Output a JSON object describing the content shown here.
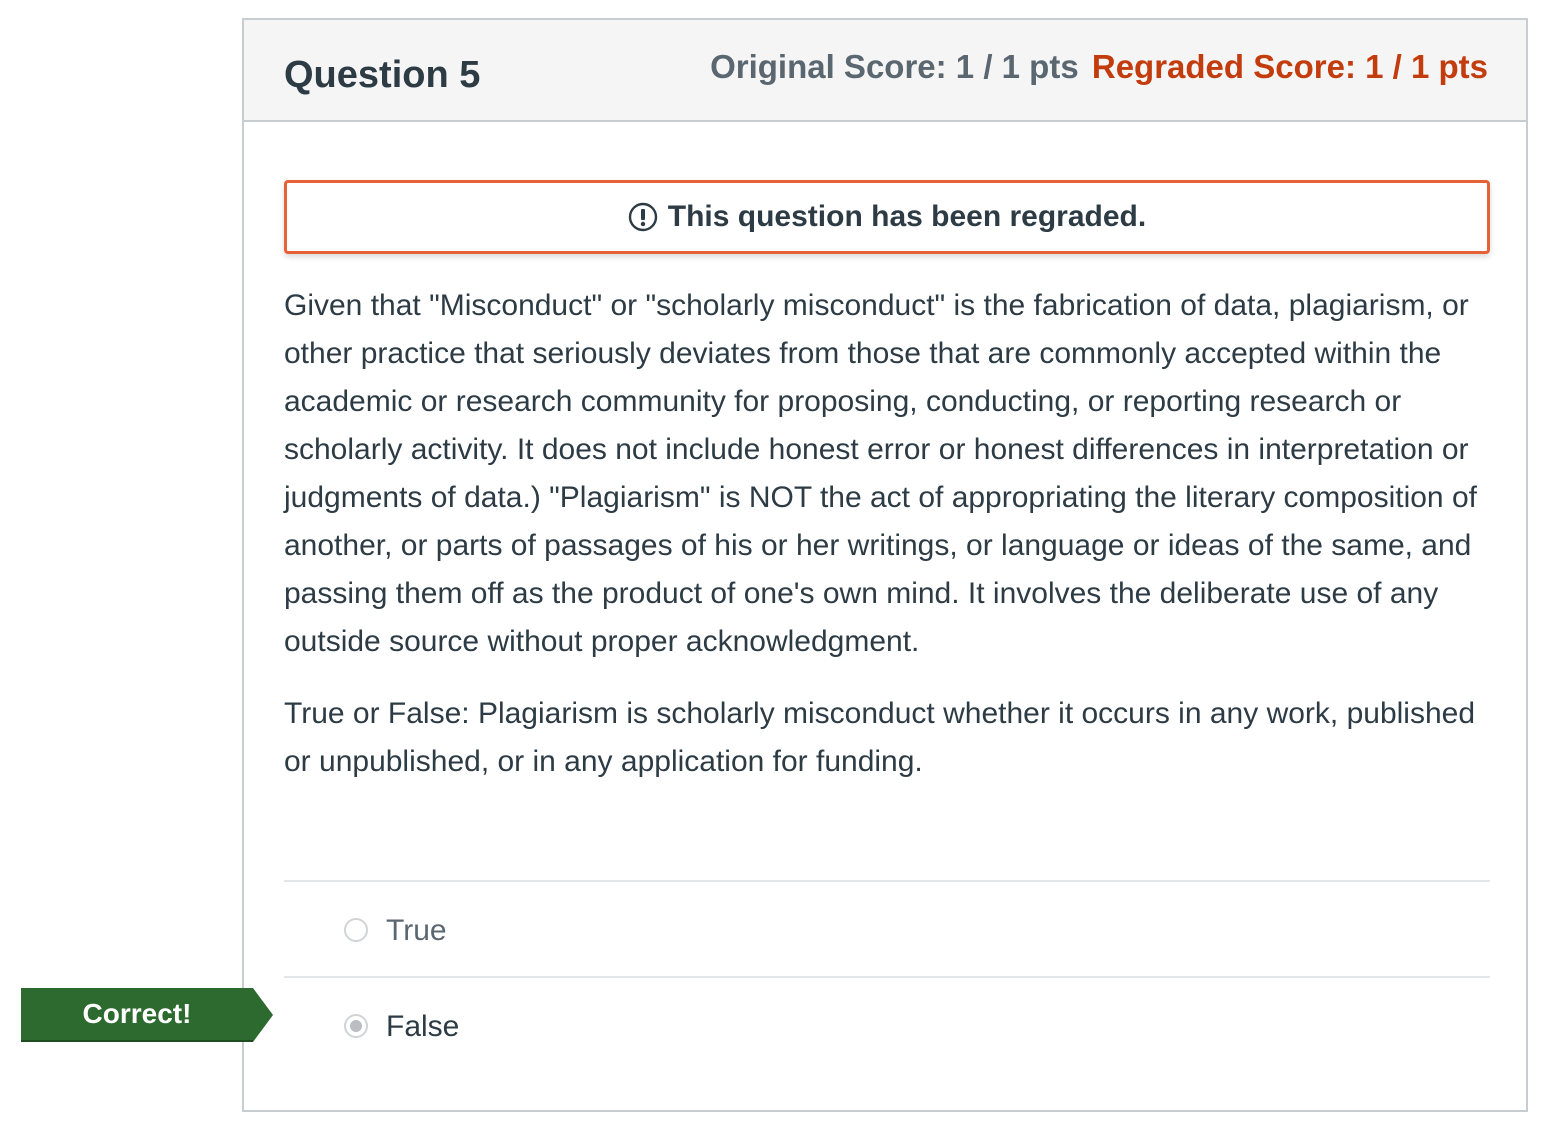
{
  "question": {
    "title": "Question 5",
    "original_score": "Original Score: 1 / 1 pts",
    "regraded_score": "Regraded Score: 1 / 1 pts",
    "regrade_notice": "This question has been regraded.",
    "text_paragraph_1": "Given that \"Misconduct\" or \"scholarly misconduct\" is the fabrication of data, plagiarism, or other practice that seriously deviates from those that are commonly accepted within the academic or research community for proposing, conducting, or reporting research or scholarly activity. It does not include honest error or honest differences in interpretation or judgments of data.)  \"Plagiarism\" is NOT the act of appropriating the literary composition of another, or parts of passages of his or her writings, or language or ideas of the same, and passing them off as the product of one's own mind. It involves the deliberate use of any outside source without proper acknowledgment.",
    "text_paragraph_2": "True or False: Plagiarism is scholarly misconduct whether it occurs in any work, published or unpublished, or in any application for funding.",
    "answers": [
      {
        "label": "True",
        "selected": false
      },
      {
        "label": "False",
        "selected": true
      }
    ],
    "correct_flag": "Correct!"
  },
  "colors": {
    "regraded_score": "#c23c0d",
    "notice_border": "#e66135",
    "correct_flag": "#2d6a2f"
  },
  "icons": {
    "notice": "warning-circle-icon"
  }
}
